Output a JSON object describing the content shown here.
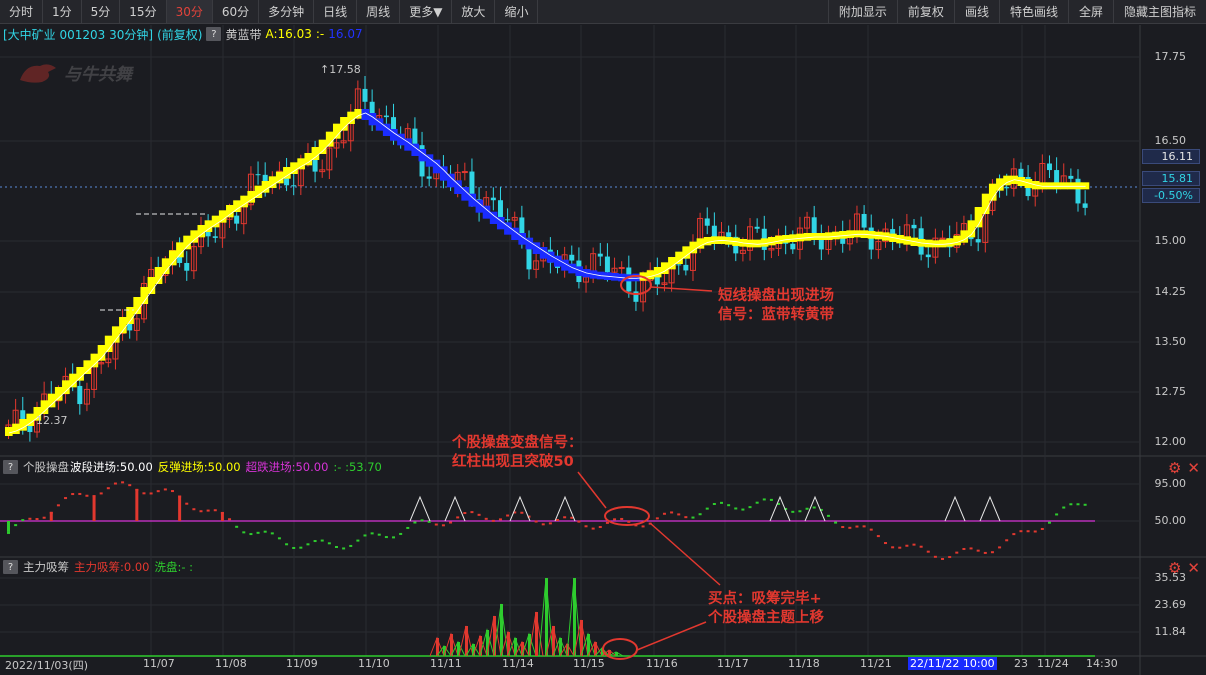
{
  "toolbar": {
    "periods": [
      "分时",
      "1分",
      "5分",
      "15分",
      "30分",
      "60分",
      "多分钟",
      "日线",
      "周线",
      "更多▼",
      "放大",
      "缩小"
    ],
    "active_period": "30分",
    "right": [
      "附加显示",
      "前复权",
      "画线",
      "特色画线",
      "全屏",
      "隐藏主图指标"
    ]
  },
  "info": {
    "stock": "[大中矿业 001203 30分钟]",
    "fq": "(前复权)",
    "help": "?",
    "indicator": "黄蓝带",
    "a_label": "A:16.03",
    "sep": ":-",
    "b_value": "16.07"
  },
  "logo_text": "与牛共舞",
  "price_axis": [
    "17.75",
    "16.50",
    "15.00",
    "14.25",
    "13.50",
    "12.75",
    "12.00"
  ],
  "price_boxes": {
    "upper": "16.11",
    "current": "15.81",
    "change": "-0.50%"
  },
  "high_label": "17.58",
  "low_label": "12.37",
  "pane2": {
    "help": "?",
    "name": "个股操盘",
    "wave": "波段进场:50.00",
    "rebound": "反弹进场:50.00",
    "oversold": "超跌进场:50.00",
    "val": ":-  :53.70",
    "axis": [
      "95.00",
      "50.00"
    ]
  },
  "pane3": {
    "help": "?",
    "name": "主力吸筹",
    "absorb": "主力吸筹:0.00",
    "wash": "洗盘:-  :",
    "axis": [
      "35.53",
      "23.69",
      "11.84"
    ]
  },
  "dates": [
    "2022/11/03(四)",
    "11/07",
    "11/08",
    "11/09",
    "11/10",
    "11/11",
    "11/14",
    "11/15",
    "11/16",
    "11/17",
    "11/18",
    "11/21",
    "22/11/22 10:00",
    "23",
    "11/24",
    "14:30"
  ],
  "annotations": {
    "a1_line1": "短线操盘出现进场",
    "a1_line2": "信号：蓝带转黄带",
    "a2_line1": "个股操盘变盘信号：",
    "a2_line2": "红柱出现且突破50",
    "a3_line1": "买点：吸筹完毕+",
    "a3_line2": "个股操盘主题上移"
  },
  "colors": {
    "up": "#e2382f",
    "down": "#31d5e5",
    "yellow": "#ffff00",
    "blue": "#1a2cff",
    "green": "#2ecc2e",
    "magenta": "#d633d6"
  }
}
